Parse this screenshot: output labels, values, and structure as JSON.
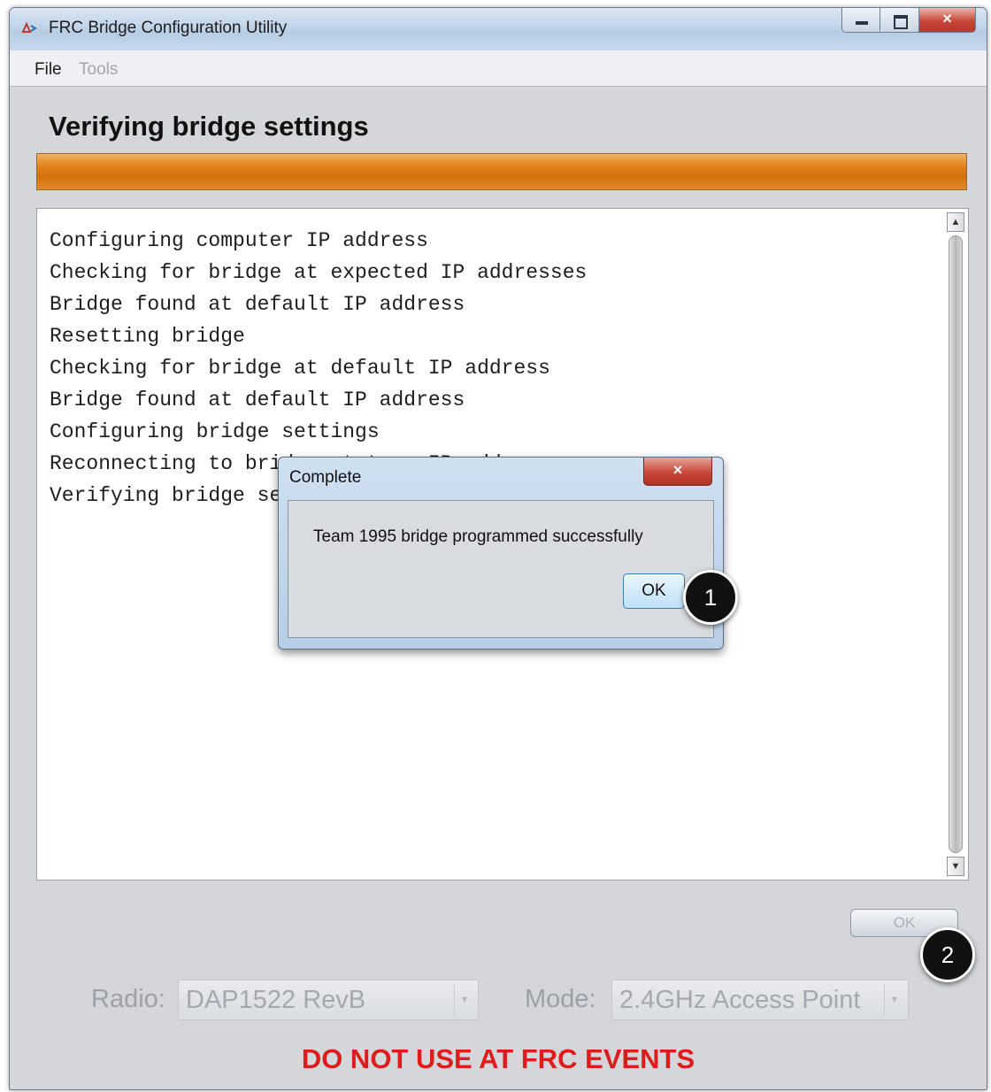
{
  "window": {
    "title": "FRC Bridge Configuration Utility",
    "controls": {
      "minimize": "minimize-icon",
      "maximize": "maximize-icon",
      "close": "×"
    }
  },
  "menu": {
    "file": "File",
    "tools": "Tools"
  },
  "main": {
    "heading": "Verifying bridge settings",
    "progress_fraction": 1.0,
    "progress_color": "#e2821a",
    "log_lines": [
      "Configuring computer IP address",
      "Checking for bridge at expected IP addresses",
      "Bridge found at default IP address",
      "Resetting bridge",
      "Checking for bridge at default IP address",
      "Bridge found at default IP address",
      "Configuring bridge settings",
      "Reconnecting to bridge at team IP address",
      "Verifying bridge settings"
    ],
    "ok_button": "OK"
  },
  "settings": {
    "radio_label": "Radio:",
    "radio_value": "DAP1522 RevB",
    "mode_label": "Mode:",
    "mode_value": "2.4GHz Access Point"
  },
  "warning": {
    "text": "DO NOT USE AT FRC EVENTS",
    "color": "#e01b1b"
  },
  "dialog": {
    "title": "Complete",
    "close": "×",
    "message": "Team 1995 bridge programmed successfully",
    "ok": "OK"
  },
  "callouts": {
    "one": "1",
    "two": "2"
  }
}
